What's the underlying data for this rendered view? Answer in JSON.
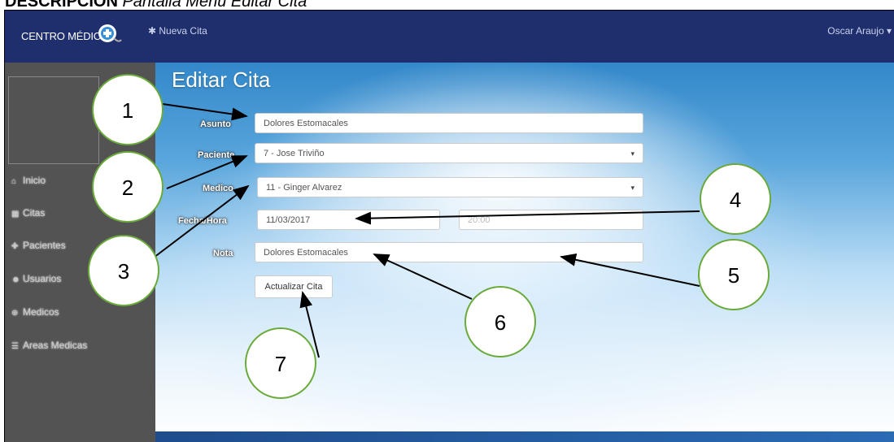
{
  "caption": {
    "bold": "DESCRIPCIÓN",
    "rest": " Pantalla Menú Editar Cita"
  },
  "navbar": {
    "brand": "CENTRO MÉDICO",
    "new_appointment": "✱ Nueva Cita",
    "user": "Oscar Araujo ▾"
  },
  "sidebar": {
    "items": [
      {
        "icon": "home-icon",
        "glyph": "⌂",
        "label": "Inicio"
      },
      {
        "icon": "calendar-icon",
        "glyph": "▦",
        "label": "Citas"
      },
      {
        "icon": "patient-icon",
        "glyph": "✚",
        "label": "Pacientes"
      },
      {
        "icon": "users-icon",
        "glyph": "☻",
        "label": "Usuarios"
      },
      {
        "icon": "doctors-icon",
        "glyph": "⊕",
        "label": "Medicos"
      },
      {
        "icon": "list-icon",
        "glyph": "☰",
        "label": "Areas Medicas"
      }
    ]
  },
  "form": {
    "title": "Editar Cita",
    "asunto_label": "Asunto",
    "asunto_value": "Dolores Estomacales",
    "paciente_label": "Paciente",
    "paciente_value": "7 - Jose Triviño",
    "medico_label": "Medico",
    "medico_value": "11 - Ginger Alvarez",
    "fecha_label": "Fecha/Hora",
    "fecha_value": "11/03/2017",
    "hora_value": "20:00",
    "nota_label": "Nota",
    "nota_value": "Dolores Estomacales",
    "submit_label": "Actualizar Cita"
  },
  "callouts": [
    "1",
    "2",
    "3",
    "4",
    "5",
    "6",
    "7"
  ],
  "colors": {
    "navbar": "#1f2f6e",
    "sidebar": "#535353",
    "callout_circle": "#6aaa3a"
  }
}
